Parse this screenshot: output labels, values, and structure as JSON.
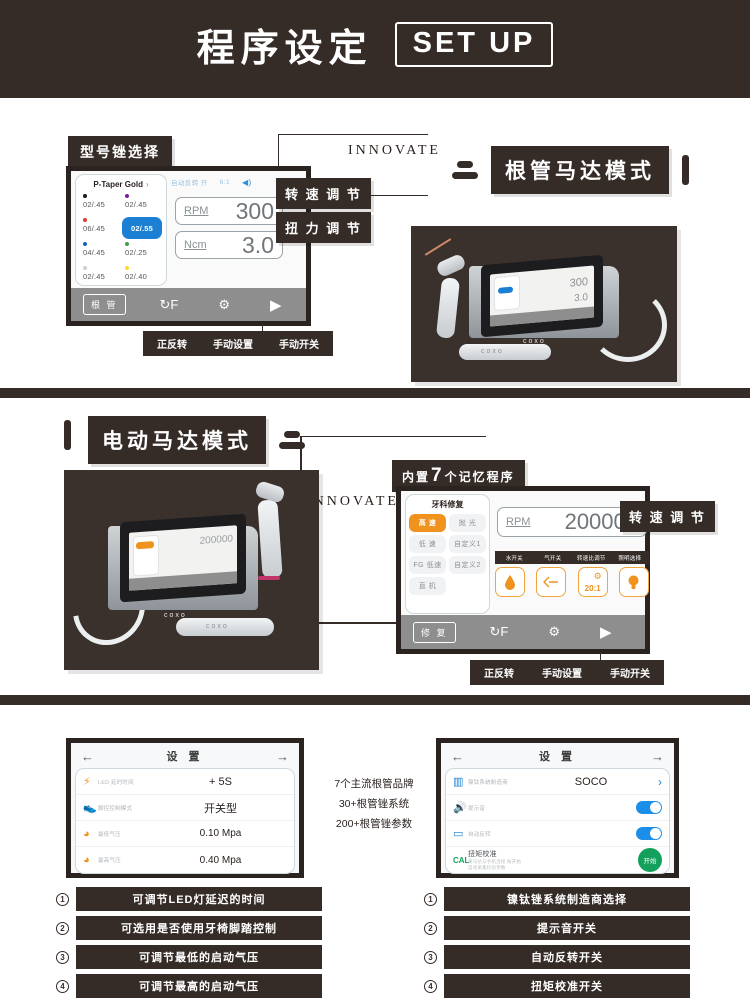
{
  "header": {
    "title": "程序设定",
    "badge": "SET UP"
  },
  "section1": {
    "tag_model": "型号锉选择",
    "innovate": "INNOVATE",
    "mode_title": "根管马达模式",
    "screen": {
      "file_panel_title": "P-Taper Gold",
      "chevron": "›",
      "status_auto_reverse": "自动反转 开",
      "status_ratio": "6:1",
      "speaker_icon": "🔊",
      "files": [
        {
          "label": "02/.45",
          "color": "#1a1a1a",
          "selected": false
        },
        {
          "label": "02/.45",
          "color": "#7b1fa2",
          "selected": false
        },
        {
          "label": "06/.45",
          "color": "#e53935",
          "selected": false
        },
        {
          "label": "02/.55",
          "color": "#1b7fd4",
          "selected": true
        },
        {
          "label": "04/.45",
          "color": "#1565c0",
          "selected": false
        },
        {
          "label": "02/.25",
          "color": "#43a047",
          "selected": false
        },
        {
          "label": "02/.45",
          "color": "#9e9e9e",
          "selected": false
        },
        {
          "label": "02/.40",
          "color": "#fdd835",
          "selected": false
        }
      ],
      "rpm_unit": "RPM",
      "rpm_value": "300",
      "ncm_unit": "Ncm",
      "ncm_value": "3.0",
      "toolbar": {
        "mode_chip": "根 管",
        "reverse_icon": "F",
        "settings_icon": "⚙",
        "play_icon": "▶"
      }
    },
    "callout_rpm": "转 速 调 节",
    "callout_ncm": "扭 力 调 节",
    "bottom_labels": [
      "正反转",
      "手动设置",
      "手动开关"
    ]
  },
  "section2": {
    "mode_title": "电动马达模式",
    "innovate": "INNOVATE",
    "tag_memory_prefix": "内置",
    "tag_memory_num": "7",
    "tag_memory_suffix": "个记忆程序",
    "screen": {
      "menu_title": "牙科修复",
      "menu_buttons": [
        {
          "label": "高 速",
          "selected": true
        },
        {
          "label": "抛 光",
          "selected": false
        },
        {
          "label": "低 速",
          "selected": false
        },
        {
          "label": "自定义1",
          "selected": false
        },
        {
          "label": "FG 低速",
          "selected": false
        },
        {
          "label": "自定义2",
          "selected": false
        },
        {
          "label": "直 机",
          "selected": false
        }
      ],
      "rpm_unit": "RPM",
      "rpm_value": "200000",
      "icon_labels": [
        "水开关",
        "气开关",
        "转速比调节",
        "照明选择"
      ],
      "icons": [
        {
          "name": "water-drop",
          "glyph": "💧"
        },
        {
          "name": "air-arrow",
          "glyph": "⇦"
        },
        {
          "name": "gear-ratio",
          "glyph": "20:1"
        },
        {
          "name": "light-bulb",
          "glyph": "💡"
        }
      ],
      "toolbar": {
        "mode_chip": "修 复",
        "reverse_icon": "F",
        "settings_icon": "⚙",
        "play_icon": "▶"
      }
    },
    "callout_rpm": "转 速 调 节",
    "bottom_labels": [
      "正反转",
      "手动设置",
      "手动开关"
    ]
  },
  "section3": {
    "settings_left": {
      "title": "设 置",
      "back_arrow": "←",
      "next_arrow": "→",
      "rows": [
        {
          "icon": "led-icon",
          "label": "LED 延时时间",
          "value": "+ 5S"
        },
        {
          "icon": "foot-pedal-icon",
          "label": "脚控控制模式",
          "value": "开关型"
        },
        {
          "icon": "gauge-low-icon",
          "label": "最低气压",
          "value": "0.10 Mpa"
        },
        {
          "icon": "gauge-high-icon",
          "label": "最高气压",
          "value": "0.40 Mpa"
        }
      ]
    },
    "settings_right": {
      "title": "设 置",
      "back_arrow": "←",
      "next_arrow": "→",
      "rows": [
        {
          "icon": "factory-icon",
          "label": "镍钛系统制造商",
          "value": "SOCO",
          "control": "chevron"
        },
        {
          "icon": "speaker-icon",
          "label": "提示音",
          "value": "",
          "control": "toggle-on"
        },
        {
          "icon": "reverse-icon",
          "label": "自动反转",
          "value": "",
          "control": "toggle-on"
        },
        {
          "icon": "cal-icon",
          "label": "扭矩校准",
          "sub": "将马达与手机连接 按开始 自动采集校验参数",
          "value": "",
          "control": "start-button",
          "button_label": "开始"
        }
      ]
    },
    "mid_notes": [
      "7个主流根管品牌",
      "30+根管锉系统",
      "200+根管锉参数"
    ],
    "bullets_left": [
      {
        "num": "1",
        "text": "可调节LED灯延迟的时间"
      },
      {
        "num": "2",
        "text": "可选用是否使用牙椅脚踏控制"
      },
      {
        "num": "3",
        "text": "可调节最低的启动气压"
      },
      {
        "num": "4",
        "text": "可调节最高的启动气压"
      }
    ],
    "bullets_right": [
      {
        "num": "1",
        "text": "镍钛锉系统制造商选择"
      },
      {
        "num": "2",
        "text": "提示音开关"
      },
      {
        "num": "3",
        "text": "自动反转开关"
      },
      {
        "num": "4",
        "text": "扭矩校准开关"
      }
    ]
  },
  "colors": {
    "dark": "#352c28",
    "accent_orange": "#f0921e",
    "accent_blue": "#1b7fd4",
    "accent_green": "#13a05c"
  }
}
